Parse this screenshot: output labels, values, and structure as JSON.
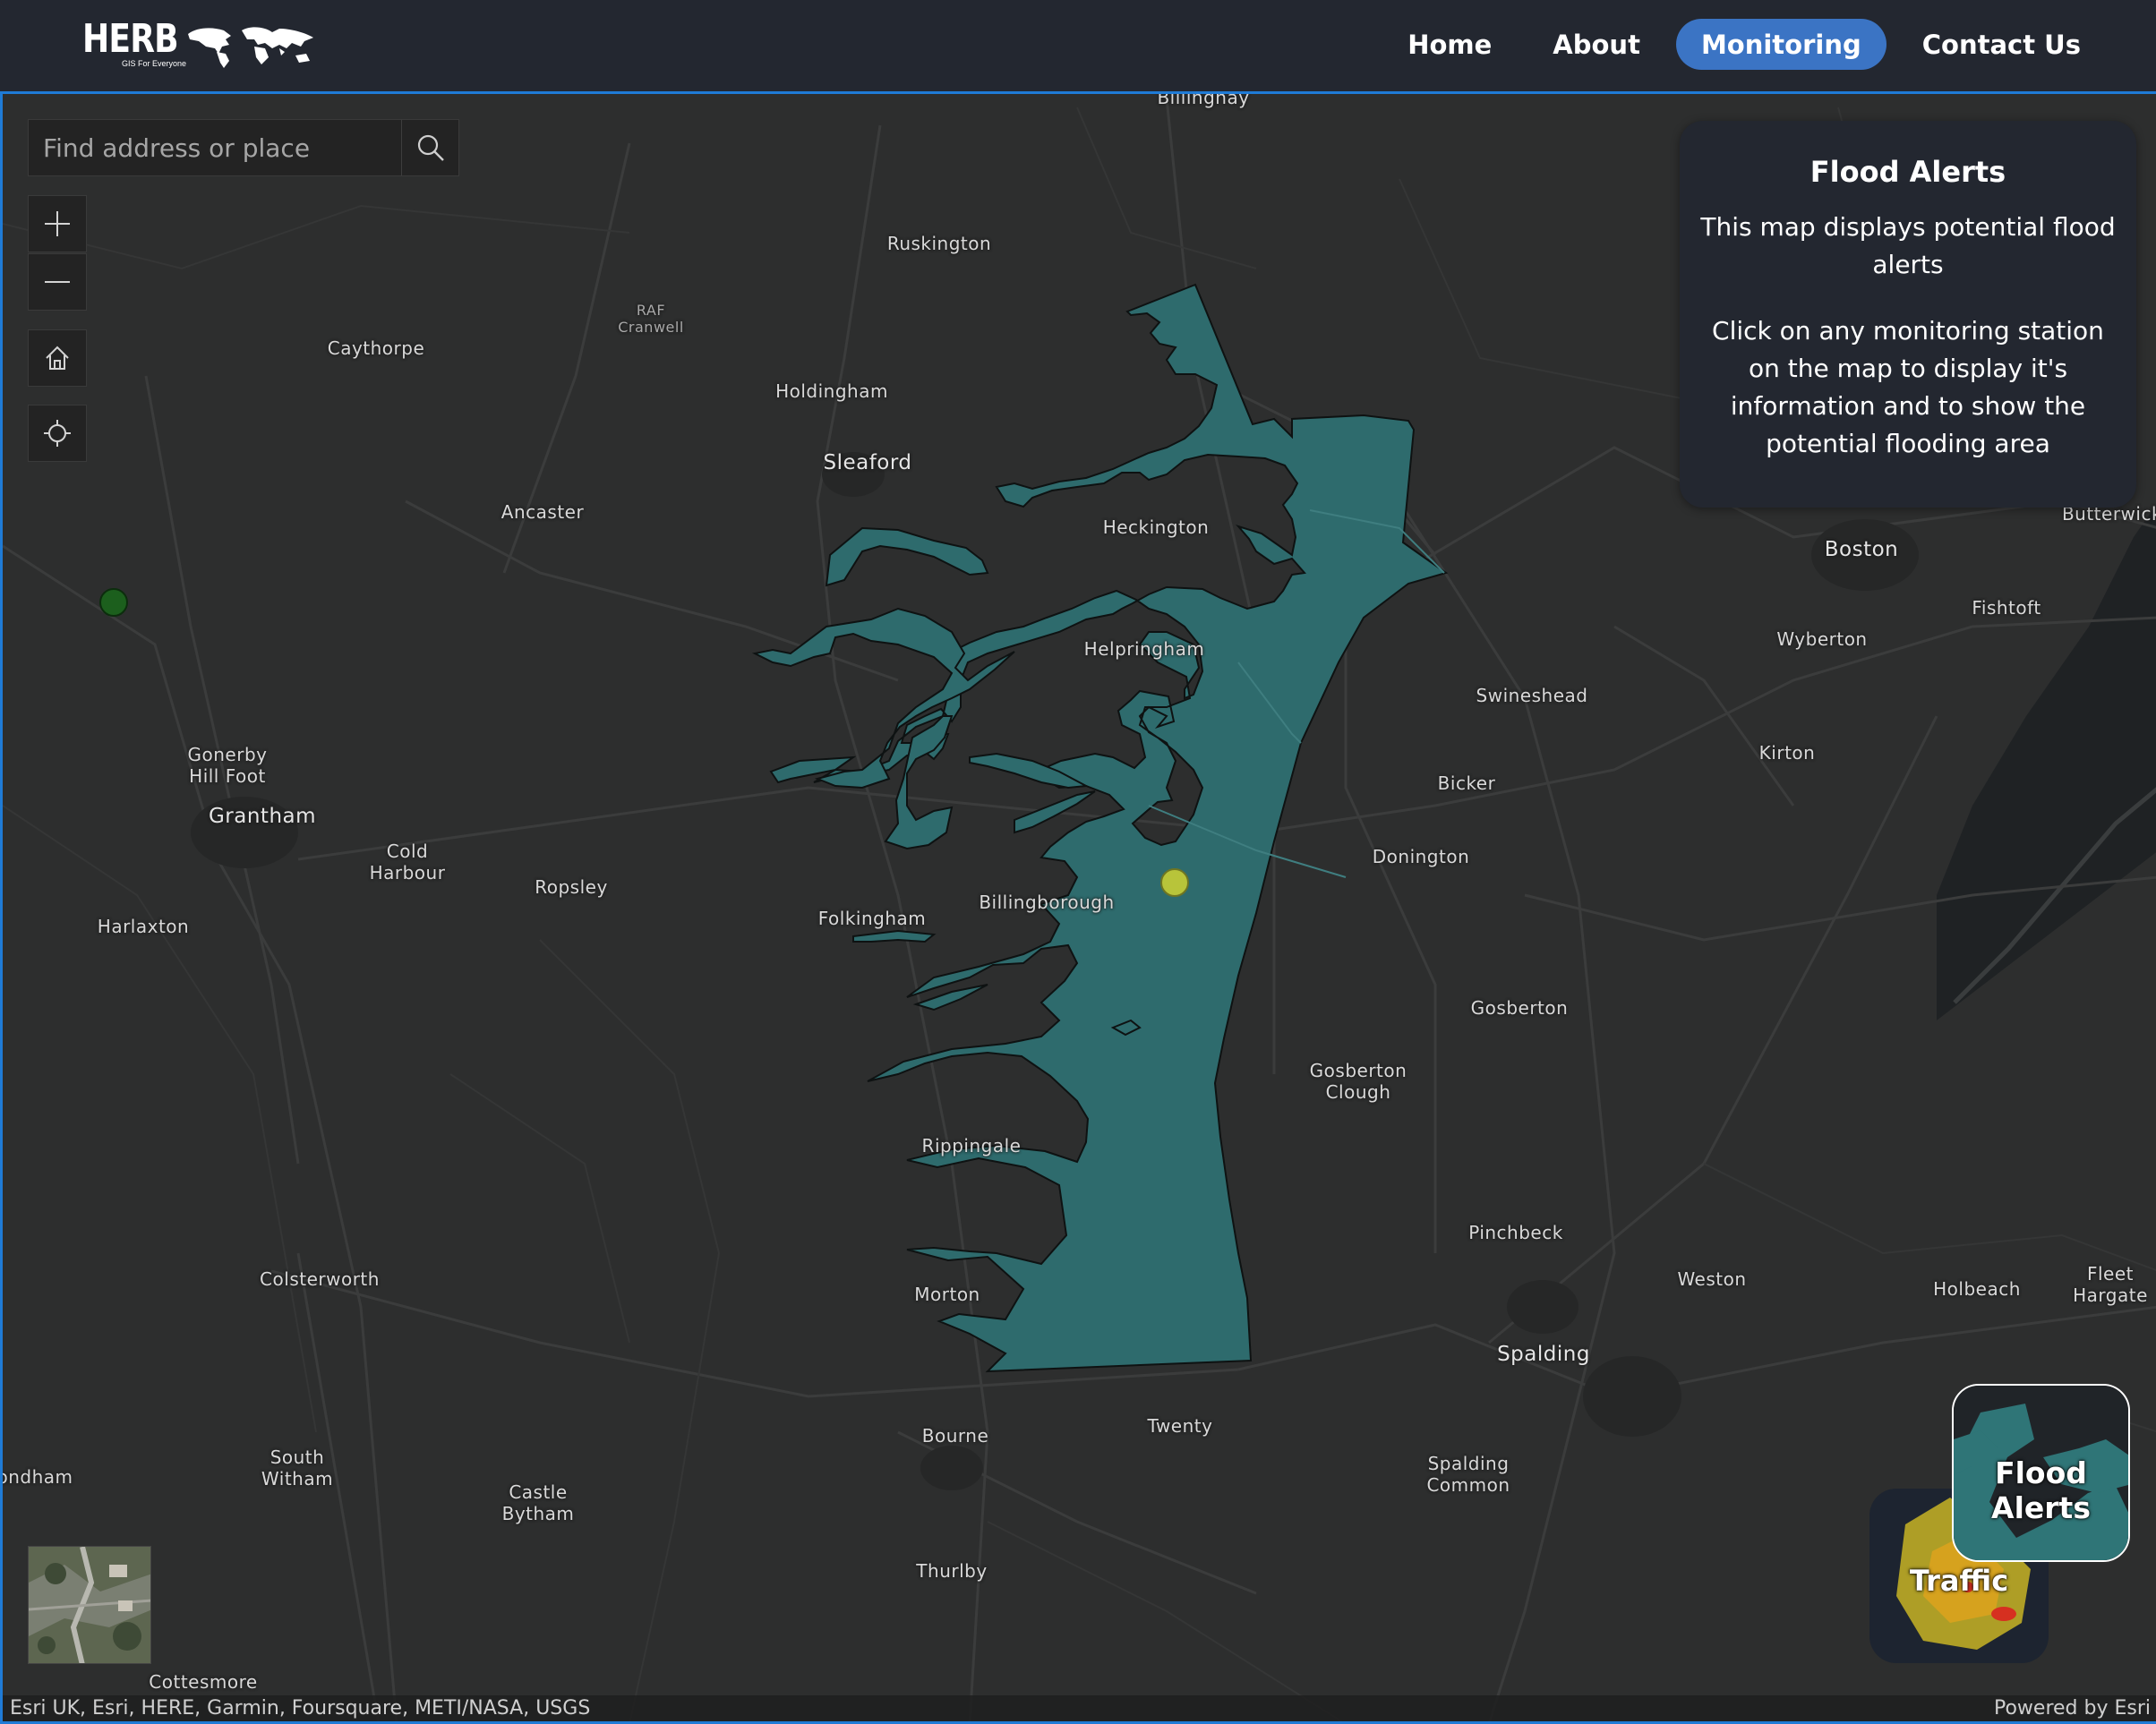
{
  "header": {
    "logo_text": "HERB",
    "logo_tagline": "GIS For Everyone",
    "nav": [
      {
        "label": "Home",
        "active": false
      },
      {
        "label": "About",
        "active": false
      },
      {
        "label": "Monitoring",
        "active": true
      },
      {
        "label": "Contact Us",
        "active": false
      }
    ],
    "accent_color": "#3b74c4"
  },
  "map": {
    "search": {
      "placeholder": "Find address or place",
      "value": ""
    },
    "controls": [
      "zoom-in-icon",
      "zoom-out-icon",
      "home-icon",
      "locate-icon"
    ],
    "info_panel": {
      "title": "Flood Alerts",
      "text1": "This map displays potential flood alerts",
      "text2": "Click on any monitoring station on the map to display it's information and to show the potential flooding area"
    },
    "flood_area_color": "#2e6b6d",
    "stations": [
      {
        "name": "station-green",
        "color": "#1c5f1d"
      },
      {
        "name": "station-yellow",
        "color": "#b8c43a"
      }
    ],
    "places": [
      "Billinghay",
      "Ruskington",
      "RAF\nCranwell",
      "Caythorpe",
      "Holdingham",
      "Sleaford",
      "Ancaster",
      "Heckington",
      "Helpringham",
      "Boston",
      "Butterwick",
      "Fishtoft",
      "Wyberton",
      "Swineshead",
      "Kirton",
      "Bicker",
      "Donington",
      "Gonerby\nHill Foot",
      "Grantham",
      "Cold\nHarbour",
      "Ropsley",
      "Harlaxton",
      "Folkingham",
      "Billingborough",
      "Gosberton",
      "Gosberton\nClough",
      "Rippingale",
      "Colsterworth",
      "Pinchbeck",
      "Weston",
      "Holbeach",
      "Fleet\nHargate",
      "Morton",
      "Spalding",
      "Bourne",
      "Twenty",
      "Spalding\nCommon",
      "South\nWitham",
      "Castle\nBytham",
      "ondham",
      "Thurlby",
      "Cottesmore"
    ],
    "layers": [
      {
        "label": "Flood Alerts",
        "selected": true
      },
      {
        "label": "Traffic",
        "selected": false
      }
    ],
    "attribution": "Esri UK, Esri, HERE, Garmin, Foursquare, METI/NASA, USGS",
    "powered_by": "Powered by Esri"
  }
}
